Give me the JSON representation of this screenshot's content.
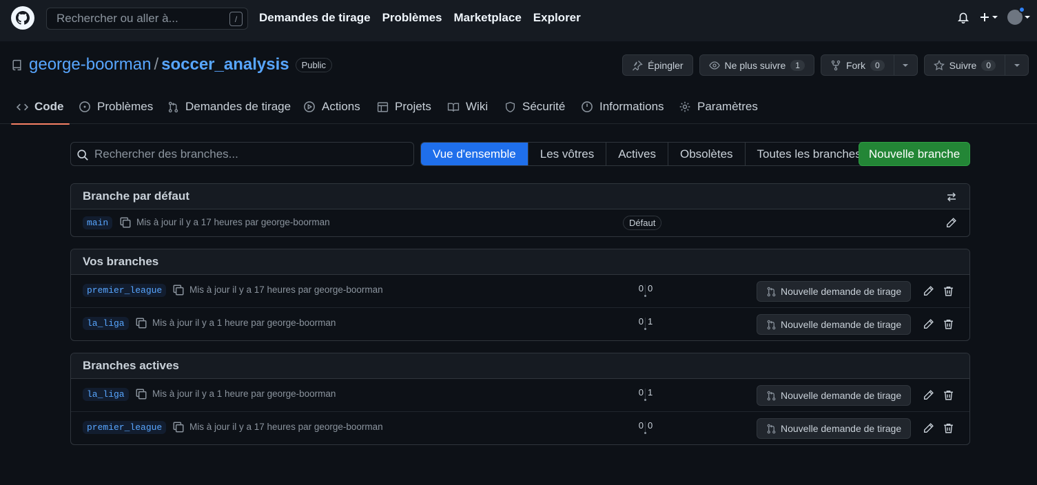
{
  "header": {
    "search_placeholder": "Rechercher ou aller à...",
    "search_shortcut": "/",
    "nav": [
      "Demandes de tirage",
      "Problèmes",
      "Marketplace",
      "Explorer"
    ]
  },
  "repo": {
    "owner": "george-boorman",
    "separator": "/",
    "name": "soccer_analysis",
    "visibility": "Public",
    "pin_label": "Épingler",
    "watch_label": "Ne plus suivre",
    "watch_count": "1",
    "fork_label": "Fork",
    "fork_count": "0",
    "star_label": "Suivre",
    "star_count": "0"
  },
  "tabs": [
    "Code",
    "Problèmes",
    "Demandes de tirage",
    "Actions",
    "Projets",
    "Wiki",
    "Sécurité",
    "Informations",
    "Paramètres"
  ],
  "branches_page": {
    "search_placeholder": "Rechercher des branches...",
    "filters": [
      "Vue d'ensemble",
      "Les vôtres",
      "Actives",
      "Obsolètes",
      "Toutes les branches"
    ],
    "active_filter": "Vue d'ensemble",
    "new_branch_label": "Nouvelle branche",
    "pr_button_label": "Nouvelle demande de tirage",
    "default_section": {
      "title": "Branche par défaut",
      "branch": {
        "name": "main",
        "updated": "Mis à jour il y a 17 heures par george-boorman",
        "label": "Défaut"
      }
    },
    "yours_section": {
      "title": "Vos branches",
      "branches": [
        {
          "name": "premier_league",
          "updated": "Mis à jour il y a 17 heures par george-boorman",
          "behind": "0",
          "ahead": "0"
        },
        {
          "name": "la_liga",
          "updated": "Mis à jour il y a 1 heure par george-boorman",
          "behind": "0",
          "ahead": "1"
        }
      ]
    },
    "active_section": {
      "title": "Branches actives",
      "branches": [
        {
          "name": "la_liga",
          "updated": "Mis à jour il y a 1 heure par george-boorman",
          "behind": "0",
          "ahead": "1"
        },
        {
          "name": "premier_league",
          "updated": "Mis à jour il y a 17 heures par george-boorman",
          "behind": "0",
          "ahead": "0"
        }
      ]
    }
  },
  "colors": {
    "accent": "#1f6feb",
    "primary_button": "#238636",
    "link": "#58a6ff",
    "tab_underline": "#f78166"
  }
}
